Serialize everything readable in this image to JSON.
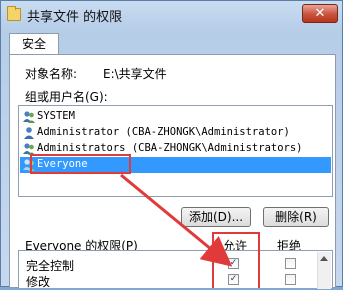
{
  "window": {
    "title": "共享文件 的权限",
    "close_glyph": "✕"
  },
  "tabs": [
    {
      "label": "安全"
    }
  ],
  "object": {
    "label": "对象名称:",
    "value": "E:\\共享文件"
  },
  "users": {
    "label": "组或用户名(G):",
    "items": [
      {
        "name": "SYSTEM",
        "selected": false
      },
      {
        "name": "Administrator (CBA-ZHONGK\\Administrator)",
        "selected": false
      },
      {
        "name": "Administrators (CBA-ZHONGK\\Administrators)",
        "selected": false
      },
      {
        "name": "Everyone",
        "selected": true
      }
    ]
  },
  "buttons": {
    "add": "添加(D)...",
    "remove": "删除(R)"
  },
  "permissions": {
    "header_label": "Everyone 的权限(P)",
    "allow_label": "允许",
    "deny_label": "拒绝",
    "rows": [
      {
        "name": "完全控制",
        "allow": true,
        "deny": false
      },
      {
        "name": "修改",
        "allow": true,
        "deny": false
      }
    ],
    "check_glyph": "✓"
  },
  "colors": {
    "annotation": "#e03a3a",
    "selection": "#3399ff"
  }
}
